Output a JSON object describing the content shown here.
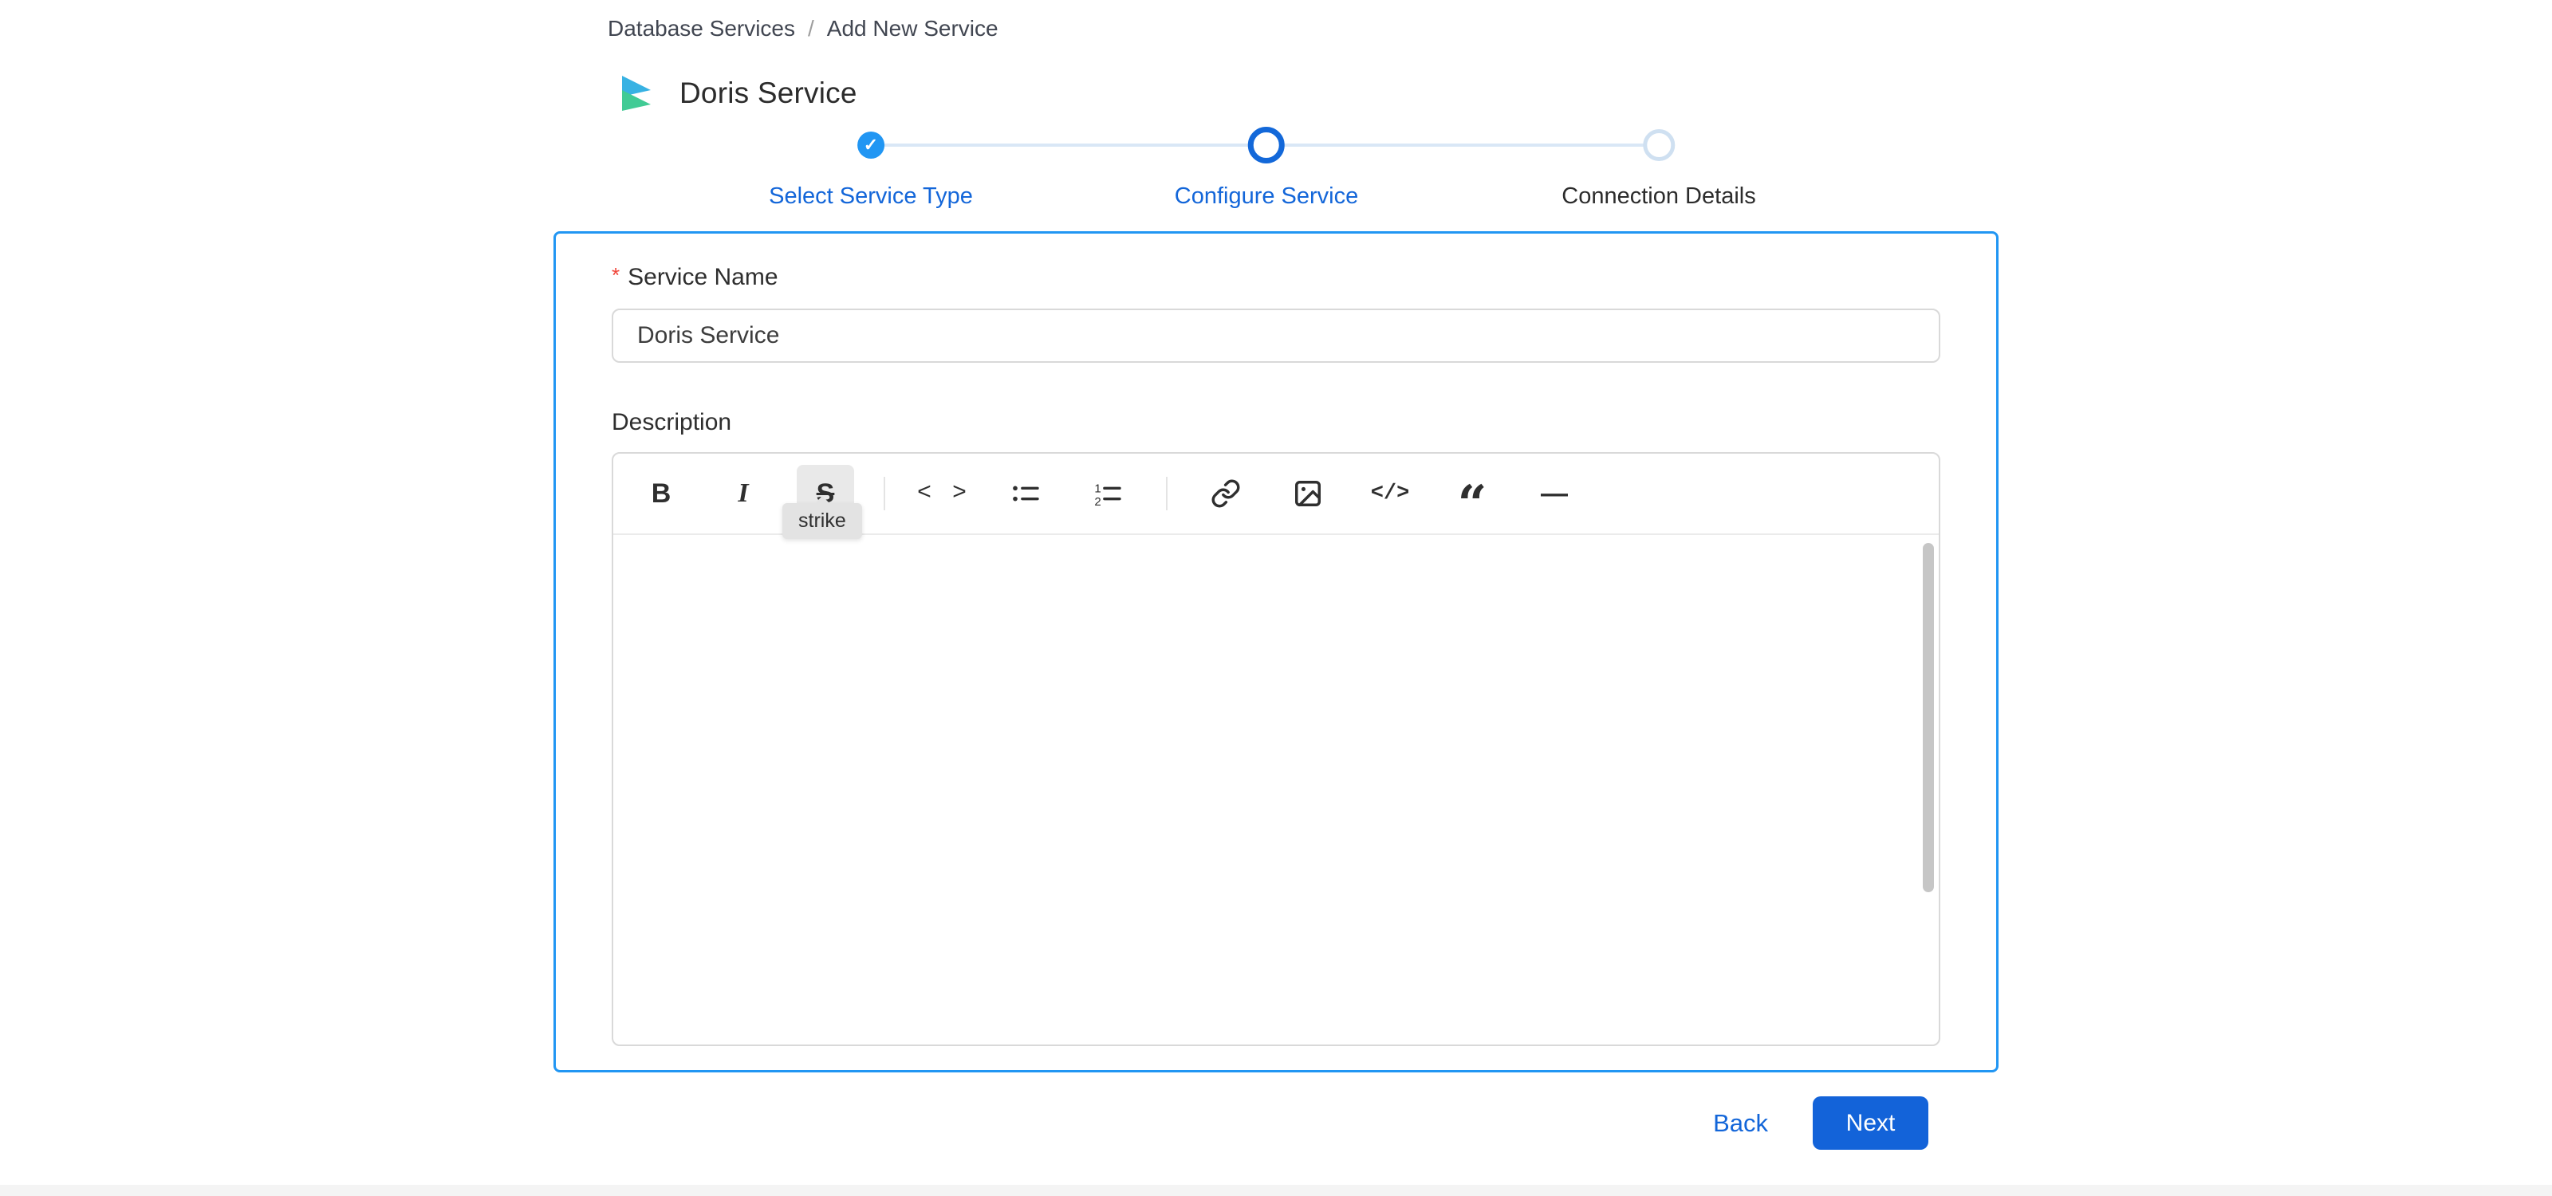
{
  "breadcrumb": {
    "items": [
      {
        "label": "Database Services"
      },
      {
        "label": "Add New Service"
      }
    ],
    "separator": "/"
  },
  "header": {
    "title": "Doris Service",
    "logo": "doris-logo"
  },
  "stepper": {
    "completed_check": "✓",
    "steps": [
      {
        "label": "Select Service Type",
        "state": "completed"
      },
      {
        "label": "Configure Service",
        "state": "active"
      },
      {
        "label": "Connection Details",
        "state": "pending"
      }
    ]
  },
  "form": {
    "service_name": {
      "required_marker": "*",
      "label": "Service Name",
      "value": "Doris Service"
    },
    "description": {
      "label": "Description"
    },
    "editor": {
      "tooltip": "strike",
      "active_tool": "strike",
      "content": "",
      "toolbar": [
        "bold",
        "italic",
        "strike",
        "inline-code",
        "bulleted-list",
        "numbered-list",
        "link",
        "image",
        "code-block",
        "quote",
        "horizontal-rule"
      ],
      "icons": {
        "bold": "B",
        "italic": "I",
        "strike": "S",
        "inline_code": "< >",
        "code_block": "</>",
        "quote": "“",
        "horizontal_rule": "—",
        "list_one": "1",
        "list_two": "2"
      }
    }
  },
  "actions": {
    "back": "Back",
    "next": "Next"
  },
  "colors": {
    "primary": "#1363d9",
    "link": "#1366d9",
    "panel_border": "#2196f3",
    "step_completed": "#2196f3",
    "step_active_ring": "#1368d9",
    "step_pending_ring": "#cfe0f1",
    "step_line": "#d9e7f6",
    "required": "#f04438",
    "tooltip_bg": "#e3e3e3",
    "text": "#3d3d3d"
  }
}
